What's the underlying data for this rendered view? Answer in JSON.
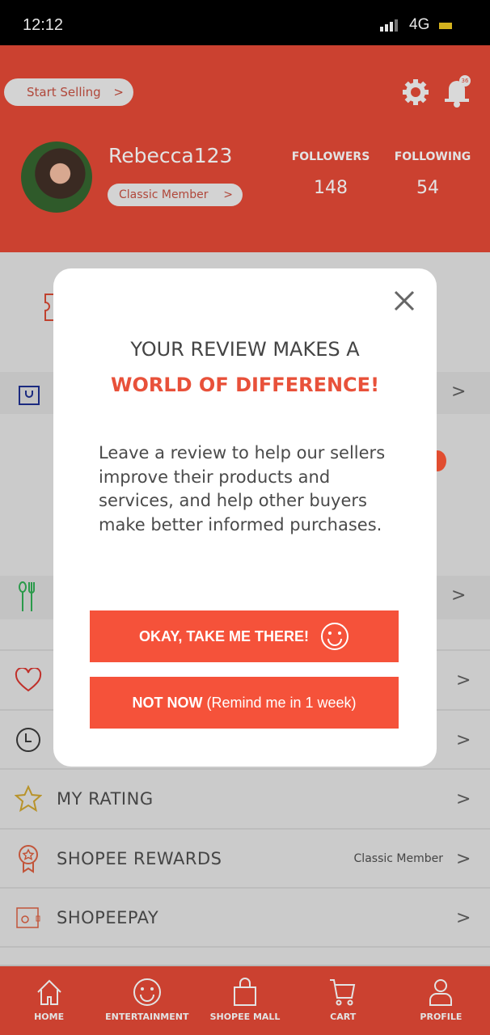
{
  "status_bar": {
    "time": "12:12",
    "network": "4G"
  },
  "header": {
    "start_selling": "Start Selling",
    "chevron": ">",
    "username": "Rebecca123",
    "membership": "Classic Member",
    "followers_label": "FOLLOWERS",
    "followers": "148",
    "following_label": "FOLLOWING",
    "following": "54",
    "notification_count": "36"
  },
  "menu": [
    {
      "label": "MY RATING",
      "icon": "star-icon",
      "chevron": ">"
    },
    {
      "label": "SHOPEE REWARDS",
      "sub": "Classic Member",
      "icon": "award-icon",
      "chevron": ">"
    },
    {
      "label": "SHOPEEPAY",
      "icon": "wallet-icon",
      "chevron": ">"
    }
  ],
  "modal": {
    "title_line1": "YOUR REVIEW MAKES A",
    "title_line2": "WORLD OF DIFFERENCE!",
    "body": "Leave a review to help our sellers improve their products and services, and help other buyers make better informed purchases.",
    "primary": "OKAY, TAKE ME THERE!",
    "secondary_bold": "NOT NOW",
    "secondary_rest": " (Remind me in 1 week)"
  },
  "nav": [
    {
      "label": "HOME"
    },
    {
      "label": "ENTERTAINMENT"
    },
    {
      "label": "SHOPEE MALL"
    },
    {
      "label": "CART"
    },
    {
      "label": "PROFILE"
    }
  ],
  "colors": {
    "brand": "#ee4d2d",
    "button": "#f5523a"
  }
}
